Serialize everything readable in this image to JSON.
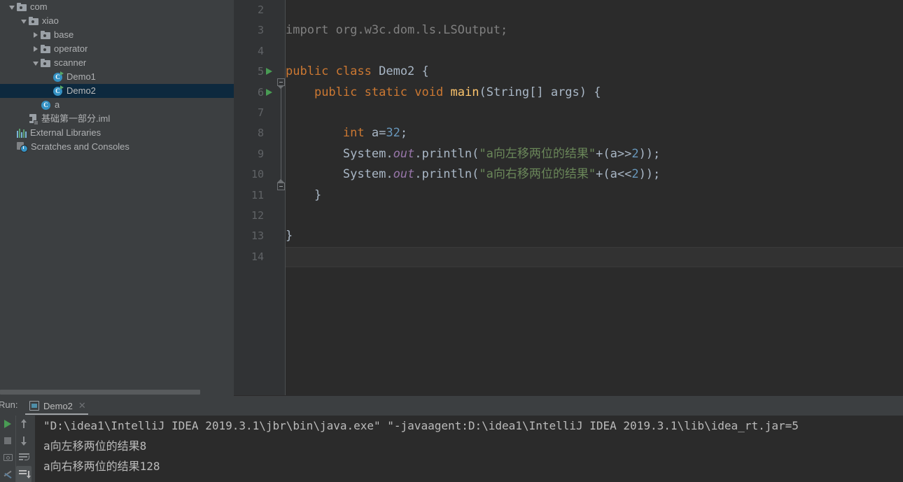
{
  "project_tree": {
    "items": [
      {
        "label": "com",
        "indent": 1,
        "twisty": "open",
        "icon": "package-folder-icon",
        "selected": false
      },
      {
        "label": "xiao",
        "indent": 2,
        "twisty": "open",
        "icon": "package-folder-icon",
        "selected": false
      },
      {
        "label": "base",
        "indent": 3,
        "twisty": "closed",
        "icon": "package-folder-icon",
        "selected": false
      },
      {
        "label": "operator",
        "indent": 3,
        "twisty": "closed",
        "icon": "package-folder-icon",
        "selected": false
      },
      {
        "label": "scanner",
        "indent": 3,
        "twisty": "open",
        "icon": "package-folder-icon",
        "selected": false
      },
      {
        "label": "Demo1",
        "indent": 4,
        "twisty": "none",
        "icon": "java-class-runnable-icon",
        "selected": false
      },
      {
        "label": "Demo2",
        "indent": 4,
        "twisty": "none",
        "icon": "java-class-runnable-icon",
        "selected": true
      },
      {
        "label": "a",
        "indent": 3,
        "twisty": "none",
        "icon": "java-class-icon",
        "selected": false
      },
      {
        "label": "基础第一部分.iml",
        "indent": 2,
        "twisty": "none",
        "icon": "iml-file-icon",
        "selected": false
      },
      {
        "label": "External Libraries",
        "indent": 1,
        "twisty": "none",
        "icon": "external-libraries-icon",
        "selected": false
      },
      {
        "label": "Scratches and Consoles",
        "indent": 1,
        "twisty": "none",
        "icon": "scratches-icon",
        "selected": false
      }
    ]
  },
  "editor": {
    "first_visible_line": 2,
    "current_line": 14,
    "lines": [
      {
        "num": 2,
        "runnable": false,
        "tokens": []
      },
      {
        "num": 3,
        "runnable": false,
        "tokens": [
          {
            "t": "import org.w3c.dom.ls.LSOutput;",
            "c": "imp",
            "indent": 0
          }
        ]
      },
      {
        "num": 4,
        "runnable": false,
        "tokens": []
      },
      {
        "num": 5,
        "runnable": true,
        "tokens": [
          {
            "t": "public",
            "c": "kw"
          },
          {
            "t": " ",
            "c": "pn"
          },
          {
            "t": "class",
            "c": "kw"
          },
          {
            "t": " ",
            "c": "pn"
          },
          {
            "t": "Demo2",
            "c": "cls"
          },
          {
            "t": " {",
            "c": "pn"
          }
        ]
      },
      {
        "num": 6,
        "runnable": true,
        "tokens": [
          {
            "t": "    ",
            "c": "pn"
          },
          {
            "t": "public",
            "c": "kw"
          },
          {
            "t": " ",
            "c": "pn"
          },
          {
            "t": "static",
            "c": "kw"
          },
          {
            "t": " ",
            "c": "pn"
          },
          {
            "t": "void",
            "c": "kw"
          },
          {
            "t": " ",
            "c": "pn"
          },
          {
            "t": "main",
            "c": "mth"
          },
          {
            "t": "(",
            "c": "pn"
          },
          {
            "t": "String",
            "c": "cls"
          },
          {
            "t": "[] args) {",
            "c": "pn"
          }
        ]
      },
      {
        "num": 7,
        "runnable": false,
        "tokens": []
      },
      {
        "num": 8,
        "runnable": false,
        "tokens": [
          {
            "t": "        ",
            "c": "pn"
          },
          {
            "t": "int",
            "c": "kw"
          },
          {
            "t": " a=",
            "c": "pn"
          },
          {
            "t": "32",
            "c": "num"
          },
          {
            "t": ";",
            "c": "pn"
          }
        ]
      },
      {
        "num": 9,
        "runnable": false,
        "tokens": [
          {
            "t": "        ",
            "c": "pn"
          },
          {
            "t": "System",
            "c": "cls"
          },
          {
            "t": ".",
            "c": "pn"
          },
          {
            "t": "out",
            "c": "fld"
          },
          {
            "t": ".println(",
            "c": "pn"
          },
          {
            "t": "\"a向左移两位的结果\"",
            "c": "str"
          },
          {
            "t": "+(a>>",
            "c": "pn"
          },
          {
            "t": "2",
            "c": "num"
          },
          {
            "t": "));",
            "c": "pn"
          }
        ]
      },
      {
        "num": 10,
        "runnable": false,
        "tokens": [
          {
            "t": "        ",
            "c": "pn"
          },
          {
            "t": "System",
            "c": "cls"
          },
          {
            "t": ".",
            "c": "pn"
          },
          {
            "t": "out",
            "c": "fld"
          },
          {
            "t": ".println(",
            "c": "pn"
          },
          {
            "t": "\"a向右移两位的结果\"",
            "c": "str"
          },
          {
            "t": "+(a<<",
            "c": "pn"
          },
          {
            "t": "2",
            "c": "num"
          },
          {
            "t": "));",
            "c": "pn"
          }
        ]
      },
      {
        "num": 11,
        "runnable": false,
        "tokens": [
          {
            "t": "    }",
            "c": "pn"
          }
        ]
      },
      {
        "num": 12,
        "runnable": false,
        "tokens": []
      },
      {
        "num": 13,
        "runnable": false,
        "tokens": [
          {
            "t": "}",
            "c": "pn"
          }
        ]
      },
      {
        "num": 14,
        "runnable": false,
        "tokens": []
      }
    ]
  },
  "run_window": {
    "label": "Run:",
    "tab_name": "Demo2",
    "tab_close": "✕",
    "toolbar": {
      "rerun": "rerun-icon",
      "stop": "stop-icon",
      "screenshot": "camera-icon",
      "settings": "wrench-icon",
      "up": "arrow-up-icon",
      "down": "arrow-down-icon",
      "wrap": "soft-wrap-icon",
      "scroll_end": "scroll-to-end-icon"
    },
    "console_lines": [
      "\"D:\\idea1\\IntelliJ IDEA 2019.3.1\\jbr\\bin\\java.exe\" \"-javaagent:D:\\idea1\\IntelliJ IDEA 2019.3.1\\lib\\idea_rt.jar=5",
      "a向左移两位的结果8",
      "a向右移两位的结果128"
    ]
  },
  "colors": {
    "panel_bg": "#3C3F41",
    "editor_bg": "#2B2B2B",
    "gutter_bg": "#313335",
    "selection_bg": "#0D293E",
    "keyword": "#CC7832",
    "string": "#6A8759",
    "number": "#6897BB",
    "field": "#9876AA",
    "method": "#FFC66D",
    "default_text": "#A9B7C6",
    "run_green": "#499C54"
  }
}
